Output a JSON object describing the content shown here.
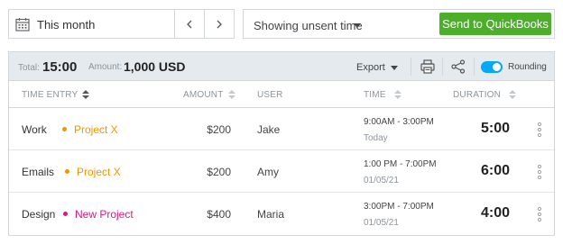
{
  "colors": {
    "border": "#d3d7dc",
    "summary_bg": "#e4eaee",
    "send_button": "#4caf2a",
    "toggle_on": "#03a9f4",
    "muted_text": "#8c959d"
  },
  "top_bar": {
    "date_range": "This month",
    "calendar_icon": "calendar-icon",
    "prev_icon": "chevron-left-icon",
    "next_icon": "chevron-right-icon",
    "filter_label": "Showing unsent time",
    "send_button": "Send to QuickBooks"
  },
  "summary": {
    "total_label": "Total:",
    "total_value": "15:00",
    "amount_label": "Amount:",
    "amount_value": "1,000 USD",
    "export_label": "Export",
    "rounding_label": "Rounding",
    "rounding_on": true
  },
  "columns": {
    "time_entry": "TIME ENTRY",
    "amount": "AMOUNT",
    "user": "USER",
    "time": "TIME",
    "duration": "DURATION"
  },
  "rows": [
    {
      "description": "Work",
      "project": "Project X",
      "project_color": "#f29500",
      "amount": "$200",
      "user": "Jake",
      "time_range": "9:00AM - 3:00PM",
      "date": "Today",
      "duration": "5:00"
    },
    {
      "description": "Emails",
      "project": "Project X",
      "project_color": "#f29500",
      "amount": "$200",
      "user": "Amy",
      "time_range": "1:00 PM - 7:00PM",
      "date": "01/05/21",
      "duration": "6:00"
    },
    {
      "description": "Design",
      "project": "New Project",
      "project_color": "#e8137c",
      "amount": "$400",
      "user": "Maria",
      "time_range": "3:00PM - 7:00PM",
      "date": "01/05/21",
      "duration": "4:00"
    }
  ]
}
